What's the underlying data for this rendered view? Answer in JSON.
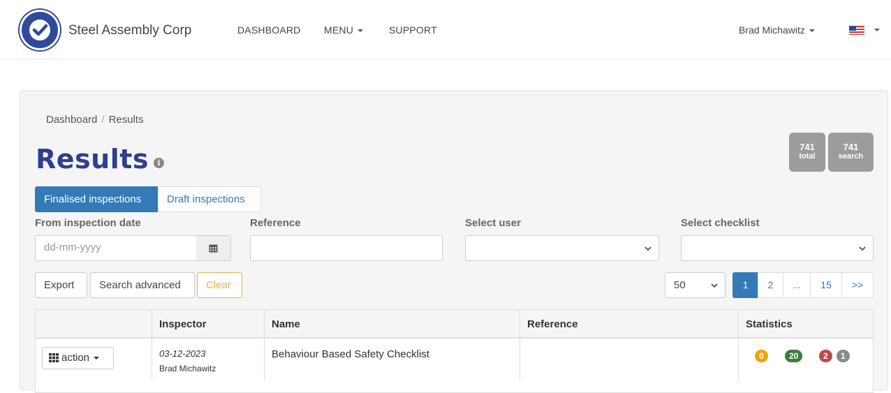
{
  "nav": {
    "brand": "Steel Assembly Corp",
    "links": [
      "DASHBOARD",
      "MENU",
      "SUPPORT"
    ],
    "user": "Brad Michawitz",
    "language_flag": "us-flag-icon"
  },
  "breadcrumb": [
    "Dashboard",
    "Results"
  ],
  "page": {
    "title": "Results",
    "counts": [
      {
        "value": "741",
        "label": "total"
      },
      {
        "value": "741",
        "label": "search"
      }
    ]
  },
  "tabs": [
    "Finalised inspections",
    "Draft inspections"
  ],
  "filters": {
    "date_label": "From inspection date",
    "date_placeholder": "dd-mm-yyyy",
    "reference_label": "Reference",
    "user_label": "Select user",
    "checklist_label": "Select checklist"
  },
  "buttons": {
    "export": "Export",
    "search_advanced": "Search advanced",
    "clear": "Clear"
  },
  "pagination": {
    "per_page": "50",
    "pages": [
      "1",
      "2",
      "...",
      "15",
      ">>"
    ],
    "current": "1"
  },
  "table": {
    "headers": [
      "",
      "Inspector",
      "Name",
      "Reference",
      "Statistics"
    ],
    "rows": [
      {
        "action": "action",
        "date": "03-12-2023",
        "inspector": "Brad Michawitz",
        "name": "Behaviour Based Safety Checklist",
        "reference": "",
        "stats": [
          {
            "value": "0",
            "color": "#f0a30a"
          },
          {
            "value": "20",
            "color": "#3c7d3c"
          },
          {
            "value": "2",
            "color": "#b94a48"
          },
          {
            "value": "1",
            "color": "#8a8a8a"
          }
        ]
      }
    ]
  }
}
